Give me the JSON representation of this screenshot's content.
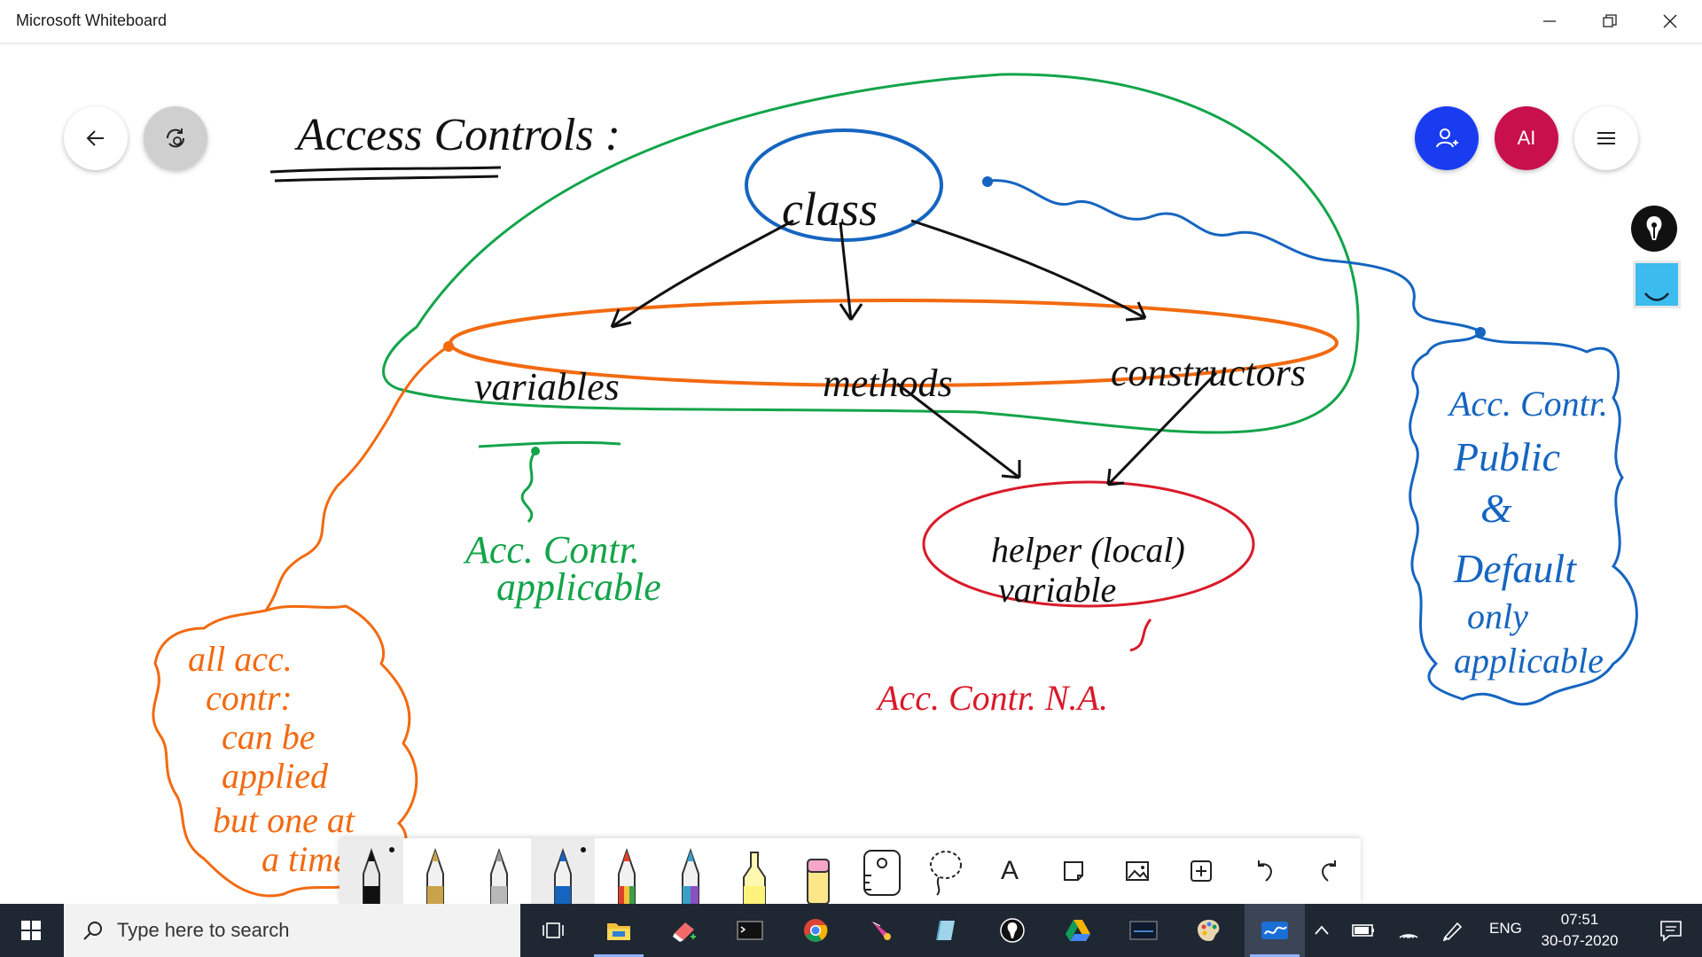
{
  "window": {
    "title": "Microsoft Whiteboard"
  },
  "board": {
    "heading": "Access Controls :",
    "nodes": {
      "class": "class",
      "variables": "variables",
      "methods": "methods",
      "constructors": "constructors",
      "helper_line1": "helper (local)",
      "helper_line2": "variable"
    },
    "notes": {
      "green_line1": "Acc. Contr.",
      "green_line2": "applicable",
      "red": "Acc. Contr. N.A.",
      "orange": [
        "all acc.",
        "contr:",
        "can be",
        "applied",
        "but one at",
        "a time."
      ],
      "blue": [
        "Acc. Contr.",
        "Public",
        "&",
        "Default",
        "only",
        "applicable"
      ]
    },
    "ink_colors": {
      "blue": "#1565c0",
      "orange": "#f26a10",
      "green": "#13a44a",
      "red": "#d81b2a",
      "black": "#111111"
    }
  },
  "header_buttons": {
    "avatar_initials": "AI"
  },
  "toolbar": {
    "tools": [
      {
        "name": "black-pen",
        "color": "#111111",
        "selected": true
      },
      {
        "name": "gold-pen",
        "color": "#c9a24a",
        "selected": false
      },
      {
        "name": "silver-pen",
        "color": "#b8b8b8",
        "selected": false
      },
      {
        "name": "blue-pen",
        "color": "#1565c0",
        "selected": true
      },
      {
        "name": "rainbow-pen",
        "color": "#e0402a",
        "selected": false
      },
      {
        "name": "galaxy-pen",
        "color": "#3aa0c8",
        "selected": false
      },
      {
        "name": "highlighter",
        "color": "#fff27a",
        "selected": false
      },
      {
        "name": "eraser",
        "color": "#f6a6c8",
        "selected": false
      }
    ],
    "text_tool_glyph": "A"
  },
  "taskbar": {
    "search_placeholder": "Type here to search",
    "language": "ENG",
    "time": "07:51",
    "date": "30-07-2020"
  }
}
